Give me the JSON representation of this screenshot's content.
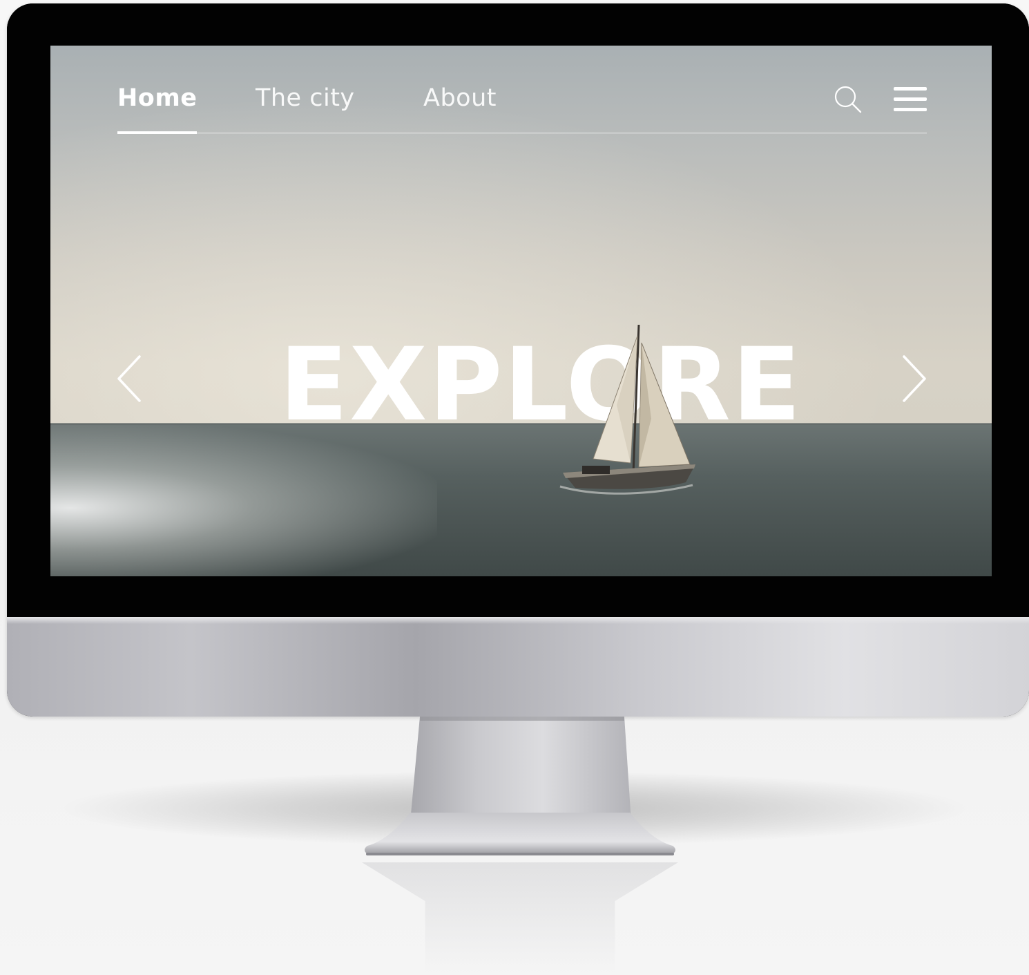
{
  "nav": {
    "items": [
      {
        "label": "Home",
        "active": true
      },
      {
        "label": "The city",
        "active": false
      },
      {
        "label": "About",
        "active": false
      }
    ],
    "search_icon": "search-icon",
    "menu_icon": "hamburger-menu-icon"
  },
  "hero": {
    "title": "EXPLORE",
    "prev_icon": "chevron-left-icon",
    "next_icon": "chevron-right-icon"
  },
  "colors": {
    "nav_text": "#ffffff",
    "bezel": "#020202",
    "chin": "#c4c4c9"
  }
}
